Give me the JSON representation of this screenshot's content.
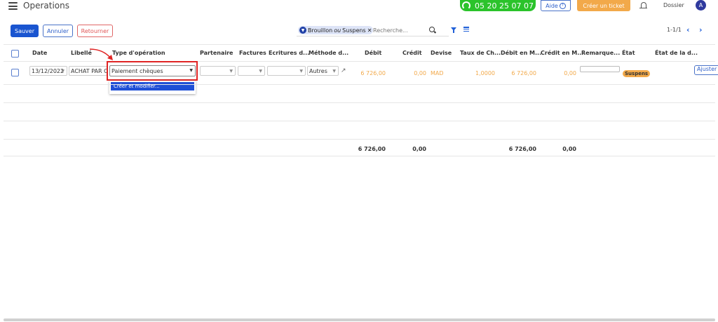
{
  "header": {
    "title": "Operations",
    "phone": "05 20 25 07 07",
    "help_label": "Aide",
    "ticket_label": "Créer un ticket",
    "dossier_label": "Dossier",
    "avatar_letter": "A"
  },
  "toolbar": {
    "save_label": "Sauver",
    "cancel_label": "Annuler",
    "return_label": "Retourner"
  },
  "search": {
    "filter_text_a": "Brouillon",
    "filter_text_or": "ou",
    "filter_text_b": "Suspens",
    "placeholder": "Recherche...",
    "pager": "1-1/1"
  },
  "table": {
    "columns": [
      "Date",
      "Libellé",
      "Type d'opération",
      "Partenaire",
      "Factures",
      "Ecritures d...",
      "Méthode d...",
      "Débit",
      "Crédit",
      "Devise",
      "Taux de Ch...",
      "Débit en M...",
      "Crédit en M...",
      "Remarque...",
      "État",
      "État de la d..."
    ],
    "row": {
      "date": "13/12/2022",
      "libelle": "ACHAT PAR CH",
      "type_operation": "Paiement chèques",
      "methode": "Autres",
      "debit": "6 726,00",
      "credit": "0,00",
      "devise": "MAD",
      "taux": "1,0000",
      "debit_m": "6 726,00",
      "credit_m": "0,00",
      "etat": "Suspens",
      "action": "Ajuster"
    },
    "totals": {
      "debit": "6 726,00",
      "credit": "0,00",
      "debit_m": "6 726,00",
      "credit_m": "0,00"
    }
  },
  "dropdown": {
    "option": "Créer et modifier..."
  },
  "colors": {
    "primary": "#1a55d0",
    "phone_green": "#2bc32b",
    "ticket_orange": "#f2a94a",
    "highlight_red": "#e02424"
  }
}
